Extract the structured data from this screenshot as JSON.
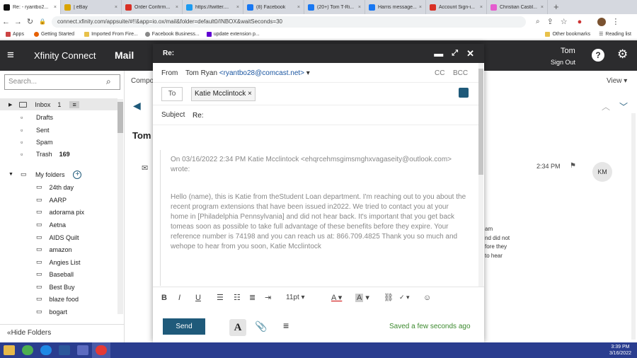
{
  "browser": {
    "tabs": [
      {
        "label": "Re: - ryantbo2...",
        "color": "#111111"
      },
      {
        "label": "| eBay",
        "color": "#d9a400"
      },
      {
        "label": "Order Confirm...",
        "color": "#d93025"
      },
      {
        "label": "https://twitter....",
        "color": "#1d9bf0"
      },
      {
        "label": "(8) Facebook",
        "color": "#1877f2"
      },
      {
        "label": "(20+) Tom T-Ri...",
        "color": "#1877f2"
      },
      {
        "label": "Harris message...",
        "color": "#1877f2"
      },
      {
        "label": "Account Sign-i...",
        "color": "#d93025"
      },
      {
        "label": "Christian Castil...",
        "color": "#e55ccf"
      }
    ],
    "new_tab": "+",
    "url": "connect.xfinity.com/appsuite/#!!&app=io.ox/mail&folder=default0/INBOX&waitSeconds=30",
    "bookmarks": [
      "Apps",
      "Getting Started",
      "Imported From Fire...",
      "Facebook Business...",
      "update extension p..."
    ],
    "other_bookmarks": "Other bookmarks",
    "reading_list": "Reading list"
  },
  "app": {
    "brand": "Xfinity Connect",
    "section": "Mail",
    "user_name": "Tom",
    "sign_out": "Sign Out",
    "search_placeholder": "Search...",
    "compose_partial": "Compo",
    "view_label": "View",
    "hide_folders": "Hide Folders"
  },
  "folders": [
    {
      "label": "Inbox",
      "count": "1"
    },
    {
      "label": "Drafts",
      "count": ""
    },
    {
      "label": "Sent",
      "count": ""
    },
    {
      "label": "Spam",
      "count": ""
    },
    {
      "label": "Trash",
      "count": "169"
    },
    {
      "label": "My folders",
      "count": ""
    },
    {
      "label": "24th day",
      "count": ""
    },
    {
      "label": "AARP",
      "count": ""
    },
    {
      "label": "adorama pix",
      "count": ""
    },
    {
      "label": "Aetna",
      "count": ""
    },
    {
      "label": "AIDS Quilt",
      "count": ""
    },
    {
      "label": "amazon",
      "count": ""
    },
    {
      "label": "Angies List",
      "count": ""
    },
    {
      "label": "Baseball",
      "count": ""
    },
    {
      "label": "Best Buy",
      "count": ""
    },
    {
      "label": "blaze food",
      "count": ""
    },
    {
      "label": "bogart",
      "count": ""
    }
  ],
  "background_mail": {
    "sender_partial": "Tom",
    "time": "2:34 PM",
    "avatar": "KM",
    "right_lines": [
      "am",
      "nd did not",
      "fore they",
      "to hear"
    ]
  },
  "compose": {
    "title": "Re:",
    "from_label": "From",
    "from_name": "Tom Ryan",
    "from_email": "<ryantbo28@comcast.net>",
    "cc": "CC",
    "bcc": "BCC",
    "to_label": "To",
    "recipient": "Katie Mcclintock",
    "subject_label": "Subject",
    "subject_value": "Re:",
    "quote_header": "On 03/16/2022 2:34 PM Katie Mcclintock <ehqrcehmsgimsmghxvagaseity@outlook.com> wrote:",
    "body": "Hello (name), this is Katie from theStudent Loan department. I'm reaching out to you about the recent program extensions that have been issued in2022. We tried to contact you at your home in [Philadelphia Pennsylvania] and did not hear back. It's important that you get back tomeas soon as possible to take full advantage of these benefits before they expire. Your reference number is 74198 and you can reach us at: 866.709.4825 Thank you so much and wehope to hear from you soon, Katie Mcclintock",
    "font_size": "11pt",
    "send": "Send",
    "saved_status": "Saved a few seconds ago"
  },
  "taskbar": {
    "time": "3:39 PM",
    "date": "3/16/2022"
  },
  "colors": {
    "app_bar": "#2c2c2e",
    "accent": "#1f5a7a",
    "saved_green": "#3c8a2e",
    "taskbar": "#2a3d8f"
  }
}
